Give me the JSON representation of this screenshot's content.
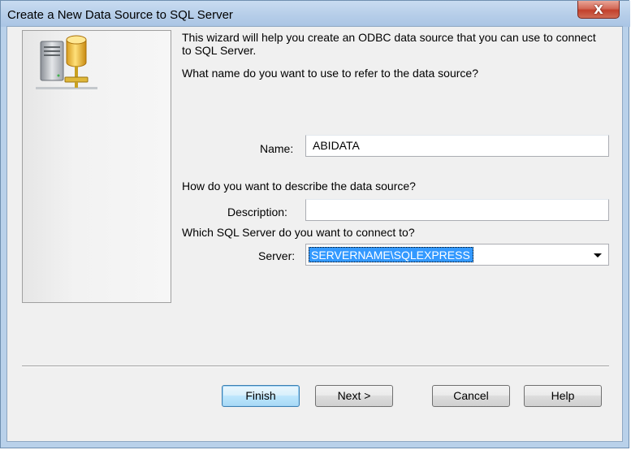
{
  "window": {
    "title": "Create a New Data Source to SQL Server",
    "close_glyph": "X"
  },
  "intro": {
    "paragraph": "This wizard will help you create an ODBC data source that you can use to connect to SQL Server.",
    "name_question": "What name do you want to use to refer to the data source?",
    "description_question": "How do you want to describe the data source?",
    "server_question": "Which SQL Server do you want to connect to?"
  },
  "form": {
    "name_label": "Name:",
    "name_value": "ABIDATA",
    "description_label": "Description:",
    "description_value": "",
    "server_label": "Server:",
    "server_value": "SERVERNAME\\SQLEXPRESS"
  },
  "buttons": {
    "finish": "Finish",
    "next": "Next >",
    "cancel": "Cancel",
    "help": "Help"
  },
  "icons": {
    "panel_image": "database-server-icon",
    "close": "close-icon",
    "dropdown": "chevron-down-icon"
  },
  "colors": {
    "titlebar": "#b9d1ea",
    "close_button": "#c2402c",
    "selection": "#3399ff",
    "default_button_border": "#3c7fb1"
  }
}
